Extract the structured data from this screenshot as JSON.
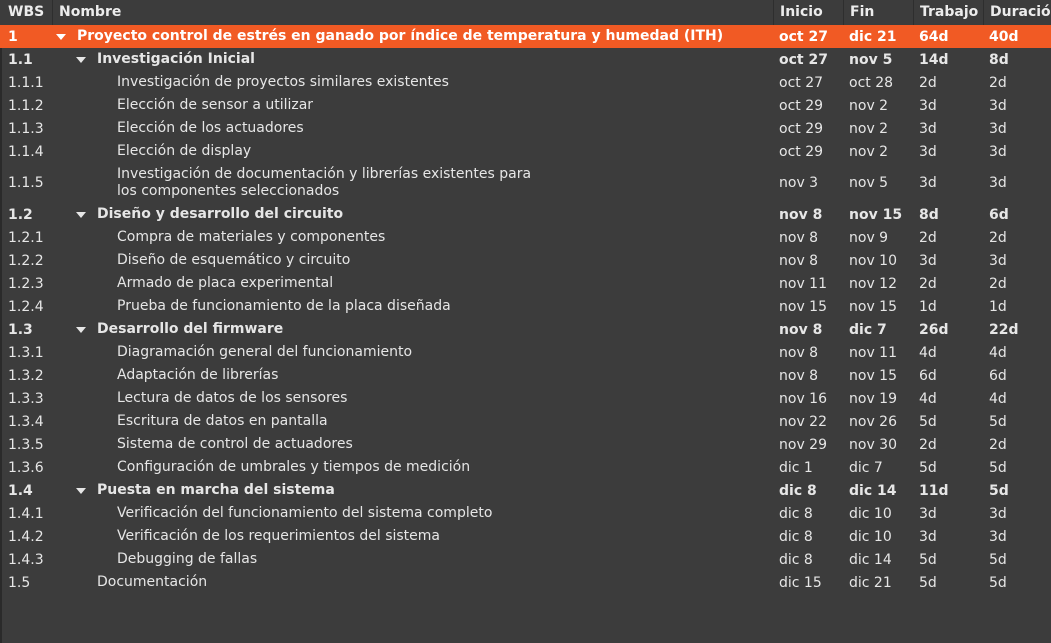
{
  "header": {
    "wbs": "WBS",
    "name": "Nombre",
    "start": "Inicio",
    "end": "Fin",
    "work": "Trabajo",
    "duration": "Duración"
  },
  "colors": {
    "selected_bg": "#f15a24",
    "background": "#3c3c3c"
  },
  "rows": [
    {
      "wbs": "1",
      "name": "Proyecto control de estrés en ganado por índice de temperatura y humedad (ITH)",
      "start": "oct 27",
      "end": "dic 21",
      "work": "64d",
      "duration": "40d",
      "level": 0,
      "bold": true,
      "expander": "expanded-icon",
      "selected": true
    },
    {
      "wbs": "1.1",
      "name": "Investigación Inicial",
      "start": "oct 27",
      "end": "nov 5",
      "work": "14d",
      "duration": "8d",
      "level": 1,
      "bold": true,
      "expander": "expanded-icon"
    },
    {
      "wbs": "1.1.1",
      "name": "Investigación de proyectos similares existentes",
      "start": "oct 27",
      "end": "oct 28",
      "work": "2d",
      "duration": "2d",
      "level": 2
    },
    {
      "wbs": "1.1.2",
      "name": "Elección de sensor a utilizar",
      "start": "oct 29",
      "end": "nov 2",
      "work": "3d",
      "duration": "3d",
      "level": 2
    },
    {
      "wbs": "1.1.3",
      "name": "Elección de los actuadores",
      "start": "oct 29",
      "end": "nov 2",
      "work": "3d",
      "duration": "3d",
      "level": 2
    },
    {
      "wbs": "1.1.4",
      "name": "Elección de display",
      "start": "oct 29",
      "end": "nov 2",
      "work": "3d",
      "duration": "3d",
      "level": 2
    },
    {
      "wbs": "1.1.5",
      "name": "Investigación de documentación y librerías existentes para los componentes seleccionados",
      "start": "nov 3",
      "end": "nov 5",
      "work": "3d",
      "duration": "3d",
      "level": 2,
      "tall": true
    },
    {
      "wbs": "1.2",
      "name": "Diseño y desarrollo del circuito",
      "start": "nov 8",
      "end": "nov 15",
      "work": "8d",
      "duration": "6d",
      "level": 1,
      "bold": true,
      "expander": "expanded-icon"
    },
    {
      "wbs": "1.2.1",
      "name": "Compra de materiales y componentes",
      "start": "nov 8",
      "end": "nov 9",
      "work": "2d",
      "duration": "2d",
      "level": 2
    },
    {
      "wbs": "1.2.2",
      "name": "Diseño de esquemático y circuito",
      "start": "nov 8",
      "end": "nov 10",
      "work": "3d",
      "duration": "3d",
      "level": 2
    },
    {
      "wbs": "1.2.3",
      "name": "Armado de placa experimental",
      "start": "nov 11",
      "end": "nov 12",
      "work": "2d",
      "duration": "2d",
      "level": 2
    },
    {
      "wbs": "1.2.4",
      "name": "Prueba de funcionamiento de la placa diseñada",
      "start": "nov 15",
      "end": "nov 15",
      "work": "1d",
      "duration": "1d",
      "level": 2
    },
    {
      "wbs": "1.3",
      "name": "Desarrollo del firmware",
      "start": "nov 8",
      "end": "dic 7",
      "work": "26d",
      "duration": "22d",
      "level": 1,
      "bold": true,
      "expander": "expanded-icon"
    },
    {
      "wbs": "1.3.1",
      "name": "Diagramación general del funcionamiento",
      "start": "nov 8",
      "end": "nov 11",
      "work": "4d",
      "duration": "4d",
      "level": 2
    },
    {
      "wbs": "1.3.2",
      "name": "Adaptación de librerías",
      "start": "nov 8",
      "end": "nov 15",
      "work": "6d",
      "duration": "6d",
      "level": 2
    },
    {
      "wbs": "1.3.3",
      "name": "Lectura de datos de los sensores",
      "start": "nov 16",
      "end": "nov 19",
      "work": "4d",
      "duration": "4d",
      "level": 2
    },
    {
      "wbs": "1.3.4",
      "name": "Escritura de datos en pantalla",
      "start": "nov 22",
      "end": "nov 26",
      "work": "5d",
      "duration": "5d",
      "level": 2
    },
    {
      "wbs": "1.3.5",
      "name": "Sistema de control de actuadores",
      "start": "nov 29",
      "end": "nov 30",
      "work": "2d",
      "duration": "2d",
      "level": 2
    },
    {
      "wbs": "1.3.6",
      "name": "Configuración de umbrales y tiempos de medición",
      "start": "dic 1",
      "end": "dic 7",
      "work": "5d",
      "duration": "5d",
      "level": 2
    },
    {
      "wbs": "1.4",
      "name": "Puesta en marcha del sistema",
      "start": "dic 8",
      "end": "dic 14",
      "work": "11d",
      "duration": "5d",
      "level": 1,
      "bold": true,
      "expander": "expanded-icon"
    },
    {
      "wbs": "1.4.1",
      "name": "Verificación del funcionamiento del sistema completo",
      "start": "dic 8",
      "end": "dic 10",
      "work": "3d",
      "duration": "3d",
      "level": 2
    },
    {
      "wbs": "1.4.2",
      "name": "Verificación de los requerimientos del sistema",
      "start": "dic 8",
      "end": "dic 10",
      "work": "3d",
      "duration": "3d",
      "level": 2
    },
    {
      "wbs": "1.4.3",
      "name": "Debugging de fallas",
      "start": "dic 8",
      "end": "dic 14",
      "work": "5d",
      "duration": "5d",
      "level": 2
    },
    {
      "wbs": "1.5",
      "name": "Documentación",
      "start": "dic 15",
      "end": "dic 21",
      "work": "5d",
      "duration": "5d",
      "level": 1
    }
  ]
}
